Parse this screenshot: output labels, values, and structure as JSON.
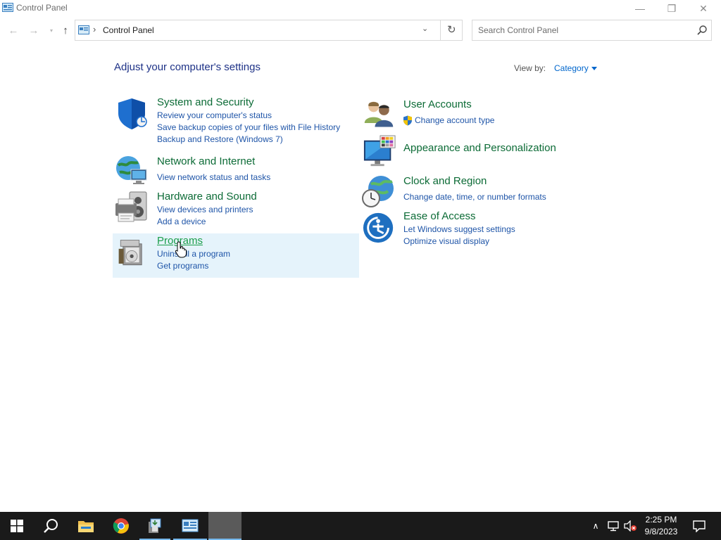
{
  "window": {
    "title": "Control Panel",
    "minimize_glyph": "—",
    "maximize_glyph": "❐",
    "close_glyph": "✕"
  },
  "nav": {
    "back_glyph": "←",
    "forward_glyph": "→",
    "recent_glyph": "▾",
    "up_glyph": "↑",
    "breadcrumb_separator": "›",
    "location": "Control Panel",
    "dropdown_glyph": "⌄",
    "refresh_glyph": "↻"
  },
  "search": {
    "placeholder": "Search Control Panel",
    "value": ""
  },
  "main": {
    "heading": "Adjust your computer's settings",
    "view_by_label": "View by:",
    "view_by_value": "Category"
  },
  "categories": {
    "system_security": {
      "title": "System and Security",
      "icon": "shield-icon",
      "links": [
        "Review your computer's status",
        "Save backup copies of your files with File History",
        "Backup and Restore (Windows 7)"
      ]
    },
    "network_internet": {
      "title": "Network and Internet",
      "icon": "network-globe-icon",
      "links": [
        "View network status and tasks"
      ]
    },
    "hardware_sound": {
      "title": "Hardware and Sound",
      "icon": "printer-speaker-icon",
      "links": [
        "View devices and printers",
        "Add a device"
      ]
    },
    "programs": {
      "title": "Programs",
      "icon": "programs-box-icon",
      "links": [
        "Uninstall a program",
        "Get programs"
      ]
    },
    "user_accounts": {
      "title": "User Accounts",
      "icon": "users-icon",
      "links": [
        "Change account type"
      ]
    },
    "appearance": {
      "title": "Appearance and Personalization",
      "icon": "monitor-palette-icon",
      "links": []
    },
    "clock_region": {
      "title": "Clock and Region",
      "icon": "clock-globe-icon",
      "links": [
        "Change date, time, or number formats"
      ]
    },
    "ease_access": {
      "title": "Ease of Access",
      "icon": "ease-of-access-icon",
      "links": [
        "Let Windows suggest settings",
        "Optimize visual display"
      ]
    }
  },
  "taskbar": {
    "time": "2:25 PM",
    "date": "9/8/2023",
    "tray_chevron": "∧",
    "apps": [
      "start-icon",
      "search-icon",
      "file-explorer-icon",
      "chrome-icon",
      "installer-icon",
      "control-panel-icon",
      "blank-app-icon"
    ]
  },
  "colors": {
    "title_green": "#0c6b36",
    "link_blue": "#1f55a8",
    "heading_blue": "#1e3287",
    "hover_bg": "#e5f3fb",
    "taskbar_bg": "#1a1a1a"
  }
}
